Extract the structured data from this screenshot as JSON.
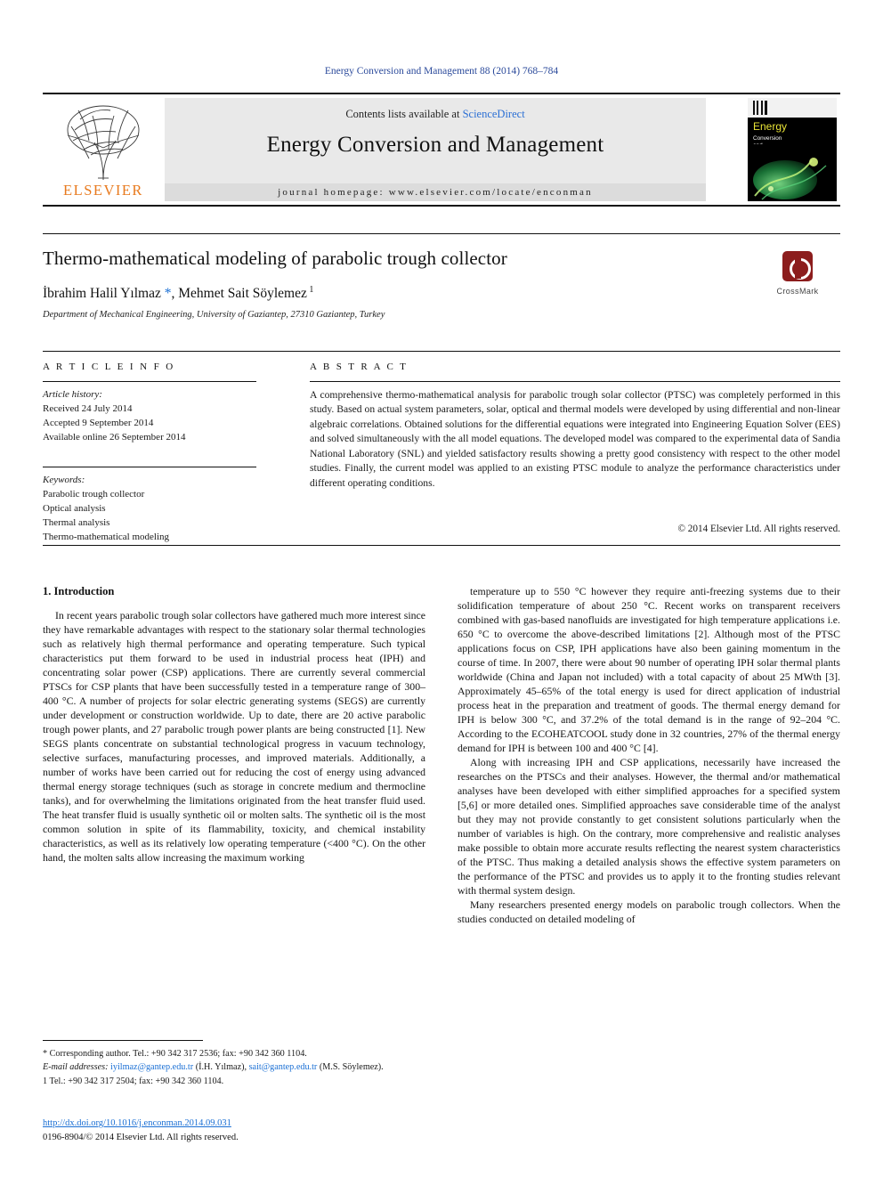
{
  "running_head": "Energy Conversion and Management 88 (2014) 768–784",
  "masthead": {
    "contents_prefix": "Contents lists available at ",
    "contents_link": "ScienceDirect",
    "journal_title": "Energy Conversion and Management",
    "homepage": "journal homepage: www.elsevier.com/locate/enconman",
    "publisher": "ELSEVIER",
    "cover": {
      "title": "Energy",
      "subtitle": "Conversion\nand\nManagement"
    }
  },
  "article": {
    "title": "Thermo-mathematical modeling of parabolic trough collector",
    "authors_html": "İbrahim Halil Yılmaz *, Mehmet Sait Söylemez 1",
    "affiliation": "Department of Mechanical Engineering, University of Gaziantep, 27310 Gaziantep, Turkey",
    "crossmark_label": "CrossMark"
  },
  "info": {
    "heading": "A R T I C L E   I N F O",
    "history_label": "Article history:",
    "received": "Received 24 July 2014",
    "accepted": "Accepted 9 September 2014",
    "available": "Available online 26 September 2014",
    "keywords_label": "Keywords:",
    "keywords": [
      "Parabolic trough collector",
      "Optical analysis",
      "Thermal analysis",
      "Thermo-mathematical modeling"
    ]
  },
  "abstract": {
    "heading": "A B S T R A C T",
    "text": "A comprehensive thermo-mathematical analysis for parabolic trough solar collector (PTSC) was completely performed in this study. Based on actual system parameters, solar, optical and thermal models were developed by using differential and non-linear algebraic correlations. Obtained solutions for the differential equations were integrated into Engineering Equation Solver (EES) and solved simultaneously with the all model equations. The developed model was compared to the experimental data of Sandia National Laboratory (SNL) and yielded satisfactory results showing a pretty good consistency with respect to the other model studies. Finally, the current model was applied to an existing PTSC module to analyze the performance characteristics under different operating conditions.",
    "rights": "© 2014 Elsevier Ltd. All rights reserved."
  },
  "body": {
    "section_title": "1. Introduction",
    "left_paragraphs": [
      "In recent years parabolic trough solar collectors have gathered much more interest since they have remarkable advantages with respect to the stationary solar thermal technologies such as relatively high thermal performance and operating temperature. Such typical characteristics put them forward to be used in industrial process heat (IPH) and concentrating solar power (CSP) applications. There are currently several commercial PTSCs for CSP plants that have been successfully tested in a temperature range of 300–400 °C. A number of projects for solar electric generating systems (SEGS) are currently under development or construction worldwide. Up to date, there are 20 active parabolic trough power plants, and 27 parabolic trough power plants are being constructed [1]. New SEGS plants concentrate on substantial technological progress in vacuum technology, selective surfaces, manufacturing processes, and improved materials. Additionally, a number of works have been carried out for reducing the cost of energy using advanced thermal energy storage techniques (such as storage in concrete medium and thermocline tanks), and for overwhelming the limitations originated from the heat transfer fluid used. The heat transfer fluid is usually synthetic oil or molten salts. The synthetic oil is the most common solution in spite of its flammability, toxicity, and chemical instability characteristics, as well as its relatively low operating temperature (<400 °C). On the other hand, the molten salts allow increasing the maximum working"
    ],
    "right_paragraphs": [
      "temperature up to 550 °C however they require anti-freezing systems due to their solidification temperature of about 250 °C. Recent works on transparent receivers combined with gas-based nanofluids are investigated for high temperature applications i.e. 650 °C to overcome the above-described limitations [2]. Although most of the PTSC applications focus on CSP, IPH applications have also been gaining momentum in the course of time. In 2007, there were about 90 number of operating IPH solar thermal plants worldwide (China and Japan not included) with a total capacity of about 25 MWth [3]. Approximately 45–65% of the total energy is used for direct application of industrial process heat in the preparation and treatment of goods. The thermal energy demand for IPH is below 300 °C, and 37.2% of the total demand is in the range of 92–204 °C. According to the ECOHEATCOOL study done in 32 countries, 27% of the thermal energy demand for IPH is between 100 and 400 °C [4].",
      "Along with increasing IPH and CSP applications, necessarily have increased the researches on the PTSCs and their analyses. However, the thermal and/or mathematical analyses have been developed with either simplified approaches for a specified system [5,6] or more detailed ones. Simplified approaches save considerable time of the analyst but they may not provide constantly to get consistent solutions particularly when the number of variables is high. On the contrary, more comprehensive and realistic analyses make possible to obtain more accurate results reflecting the nearest system characteristics of the PTSC. Thus making a detailed analysis shows the effective system parameters on the performance of the PTSC and provides us to apply it to the fronting studies relevant with thermal system design.",
      "Many researchers presented energy models on parabolic trough collectors. When the studies conducted on detailed modeling of"
    ]
  },
  "footnotes": {
    "corresponding": "* Corresponding author. Tel.: +90 342 317 2536; fax: +90 342 360 1104.",
    "email_label": "E-mail addresses:",
    "email1": "iyilmaz@gantep.edu.tr",
    "email1_name": "(İ.H. Yılmaz),",
    "email2": "sait@gantep.edu.tr",
    "email2_name": "(M.S. Söylemez).",
    "note1": "1 Tel.: +90 342 317 2504; fax: +90 342 360 1104."
  },
  "footer": {
    "doi": "http://dx.doi.org/10.1016/j.enconman.2014.09.031",
    "issn": "0196-8904/© 2014 Elsevier Ltd. All rights reserved."
  }
}
